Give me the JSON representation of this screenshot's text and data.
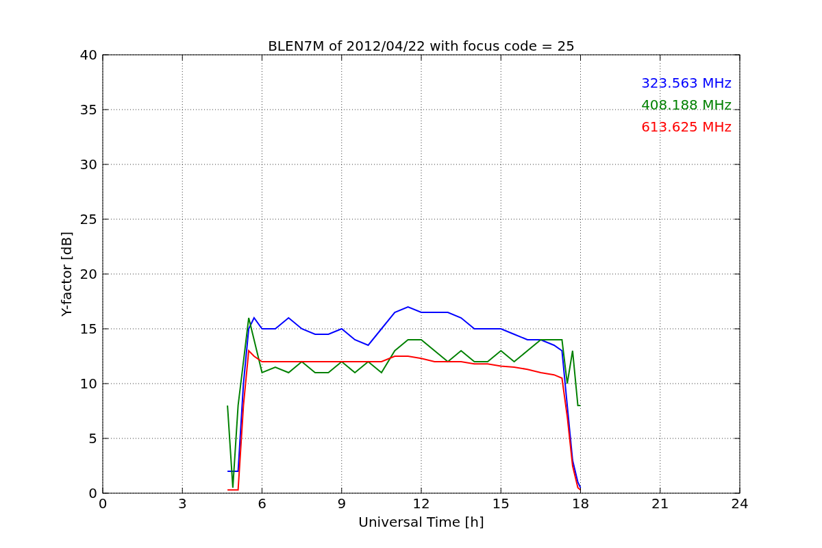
{
  "chart_data": {
    "type": "line",
    "title": "BLEN7M of 2012/04/22 with focus code = 25",
    "xlabel": "Universal Time [h]",
    "ylabel": "Y-factor [dB]",
    "x": [
      4.7,
      4.9,
      5.1,
      5.3,
      5.5,
      5.7,
      6,
      6.5,
      7,
      7.5,
      8,
      8.5,
      9,
      9.5,
      10,
      10.5,
      11,
      11.5,
      12,
      12.5,
      13,
      13.5,
      14,
      14.5,
      15,
      15.5,
      16,
      16.5,
      17,
      17.3,
      17.5,
      17.7,
      17.9,
      18.0
    ],
    "series": [
      {
        "name": "323.563 MHz",
        "color": "#0000ff",
        "values": [
          2,
          2,
          2,
          10,
          15,
          16,
          15,
          15,
          16,
          15,
          14.5,
          14.5,
          15,
          14,
          13.5,
          15,
          16.5,
          17,
          16.5,
          16.5,
          16.5,
          16,
          15,
          15,
          15,
          14.5,
          14,
          14,
          13.5,
          13,
          8,
          3,
          1,
          0.5
        ]
      },
      {
        "name": "408.188 MHz",
        "color": "#008000",
        "values": [
          8,
          0.5,
          8,
          12,
          16,
          14,
          11,
          11.5,
          11,
          12,
          11,
          11,
          12,
          11,
          12,
          11,
          13,
          14,
          14,
          13,
          12,
          13,
          12,
          12,
          13,
          12,
          13,
          14,
          14,
          14,
          10,
          13,
          8,
          8
        ]
      },
      {
        "name": "613.625 MHz",
        "color": "#ff0000",
        "values": [
          0.3,
          0.3,
          0.3,
          8,
          13,
          12.5,
          12,
          12,
          12,
          12,
          12,
          12,
          12,
          12,
          12,
          12,
          12.5,
          12.5,
          12.3,
          12,
          12,
          12,
          11.8,
          11.8,
          11.6,
          11.5,
          11.3,
          11,
          10.8,
          10.5,
          7,
          2.5,
          0.5,
          0.3
        ]
      }
    ],
    "xlim": [
      0,
      24
    ],
    "ylim": [
      0,
      40
    ],
    "xticks": [
      0,
      3,
      6,
      9,
      12,
      15,
      18,
      21,
      24
    ],
    "yticks": [
      0,
      5,
      10,
      15,
      20,
      25,
      30,
      35,
      40
    ],
    "grid": true
  }
}
